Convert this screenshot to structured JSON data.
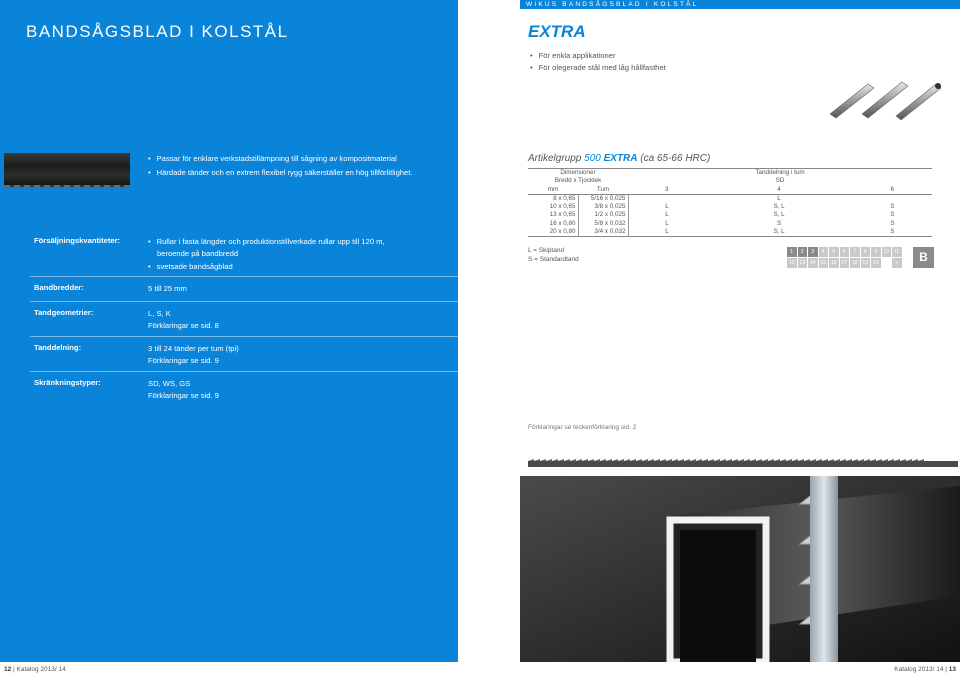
{
  "left": {
    "title": "BANDSÅGSBLAD I KOLSTÅL",
    "features": [
      "Passar för enklare verkstadstillämpning till sågning av kompositmaterial",
      "Härdade tänder och en extrem flexibel rygg säkerställer en hög tillförlitlighet."
    ],
    "sales_label": "Försäljningskvantiteter:",
    "sales_items": [
      "Rullar i fasta längder och produktionstillverkade rullar upp till 120 m, beroende på bandbredd",
      "svetsade bandsågblad"
    ],
    "rows": [
      {
        "label": "Bandbredder:",
        "lines": [
          "5 till 25 mm"
        ]
      },
      {
        "label": "Tandgeometrier:",
        "lines": [
          "L, S, K",
          "Förklaringar se sid. 8"
        ]
      },
      {
        "label": "Tanddelning:",
        "lines": [
          "3 till 24 tänder per tum (tpi)",
          "Förklaringar se sid. 9"
        ]
      },
      {
        "label": "Skränkningstyper:",
        "lines": [
          "SD, WS, GS",
          "Förklaringar se sid. 9"
        ]
      }
    ],
    "footer_page": "12",
    "footer_text": "Katalog 2013/ 14"
  },
  "right": {
    "top_bar": "WIKUS BANDSÅGSBLAD I KOLSTÅL",
    "title": "EXTRA",
    "features": [
      "För enkla applikationer",
      "För olegerade stål med låg hållfasthet"
    ],
    "artikel": {
      "prefix": "Artikelgrupp",
      "number": "500",
      "name": "EXTRA",
      "suffix": "(ca 65-66 HRC)"
    },
    "table": {
      "h1_dim": "Dimensioner",
      "h1_tand": "Tanddelning i tum",
      "h2_dim": "Bredd x Tjocklek",
      "h2_sd": "SD",
      "h3": [
        "mm",
        "Tum",
        "3",
        "4",
        "6"
      ],
      "rows": [
        [
          "8 x 0,65",
          "5/16 x 0,025",
          "",
          "L",
          ""
        ],
        [
          "10 x 0,65",
          "3/8 x 0,025",
          "L",
          "S, L",
          "S"
        ],
        [
          "13 x 0,65",
          "1/2 x 0,025",
          "L",
          "S, L",
          "S"
        ],
        [
          "16 x 0,80",
          "5/8 x 0,032",
          "L",
          "S",
          "S"
        ],
        [
          "20 x 0,80",
          "3/4 x 0,032",
          "L",
          "S, L",
          "S"
        ]
      ]
    },
    "legend": [
      "L = Skiptand",
      "S = Standardtand"
    ],
    "tpi_row1": [
      "1",
      "2",
      "3",
      "4",
      "5",
      "6",
      "7",
      "8",
      "9",
      "10",
      "11"
    ],
    "tpi_row2": [
      "12",
      "13",
      "14",
      "15",
      "16",
      "17",
      "18",
      "19",
      "20",
      "",
      "+"
    ],
    "b_label": "B",
    "footnote": "Förklaringar se teckenförklaring sid. 2",
    "footer_text": "Katalog 2013/ 14",
    "footer_page": "13"
  },
  "colors": {
    "brand_blue": "#0a84d8",
    "tpi_active": "#8a8a8a",
    "tpi_inactive": "#c9c9c9"
  }
}
